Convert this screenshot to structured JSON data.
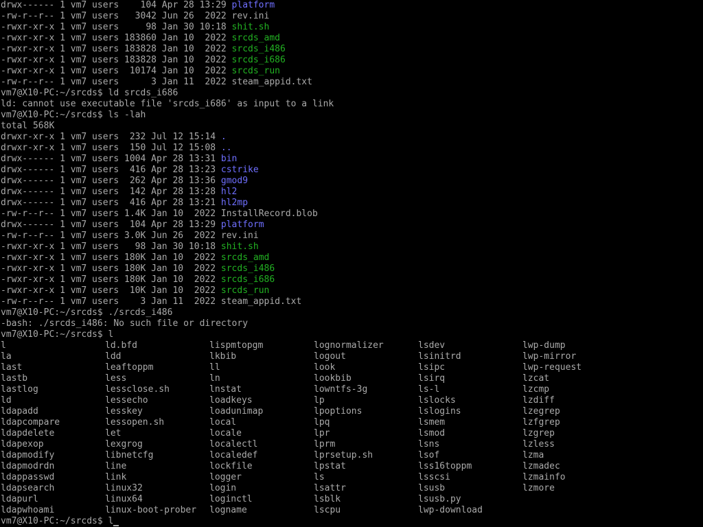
{
  "colors": {
    "background": "#000000",
    "text": "#aaaaaa",
    "directory": "#6f6fff",
    "executable": "#22b222"
  },
  "lines": [
    {
      "prefix": "drwx------ 1 vm7 users    104 Apr 28 13:29 ",
      "name": "platform",
      "kind": "dir"
    },
    {
      "prefix": "-rw-r--r-- 1 vm7 users   3042 Jun 26  2022 ",
      "name": "rev.ini",
      "kind": "plain"
    },
    {
      "prefix": "-rwxr-xr-x 1 vm7 users     98 Jan 30 10:18 ",
      "name": "shit.sh",
      "kind": "exec"
    },
    {
      "prefix": "-rwxr-xr-x 1 vm7 users 183860 Jan 10  2022 ",
      "name": "srcds_amd",
      "kind": "exec"
    },
    {
      "prefix": "-rwxr-xr-x 1 vm7 users 183828 Jan 10  2022 ",
      "name": "srcds_i486",
      "kind": "exec"
    },
    {
      "prefix": "-rwxr-xr-x 1 vm7 users 183828 Jan 10  2022 ",
      "name": "srcds_i686",
      "kind": "exec"
    },
    {
      "prefix": "-rwxr-xr-x 1 vm7 users  10174 Jan 10  2022 ",
      "name": "srcds_run",
      "kind": "exec"
    },
    {
      "prefix": "-rw-r--r-- 1 vm7 users      3 Jan 11  2022 ",
      "name": "steam_appid.txt",
      "kind": "plain"
    },
    {
      "prefix": "vm7@X10-PC:~/srcds$ ld srcds_i686",
      "name": "",
      "kind": "plain"
    },
    {
      "prefix": "ld: cannot use executable file 'srcds_i686' as input to a link",
      "name": "",
      "kind": "plain"
    },
    {
      "prefix": "vm7@X10-PC:~/srcds$ ls -lah",
      "name": "",
      "kind": "plain"
    },
    {
      "prefix": "total 568K",
      "name": "",
      "kind": "plain"
    },
    {
      "prefix": "drwxr-xr-x 1 vm7 users  232 Jul 12 15:14 ",
      "name": ".",
      "kind": "dir"
    },
    {
      "prefix": "drwxr-xr-x 1 vm7 users  150 Jul 12 15:08 ",
      "name": "..",
      "kind": "dir"
    },
    {
      "prefix": "drwx------ 1 vm7 users 1004 Apr 28 13:31 ",
      "name": "bin",
      "kind": "dir"
    },
    {
      "prefix": "drwx------ 1 vm7 users  416 Apr 28 13:23 ",
      "name": "cstrike",
      "kind": "dir"
    },
    {
      "prefix": "drwx------ 1 vm7 users  262 Apr 28 13:36 ",
      "name": "gmod9",
      "kind": "dir"
    },
    {
      "prefix": "drwx------ 1 vm7 users  142 Apr 28 13:28 ",
      "name": "hl2",
      "kind": "dir"
    },
    {
      "prefix": "drwx------ 1 vm7 users  416 Apr 28 13:21 ",
      "name": "hl2mp",
      "kind": "dir"
    },
    {
      "prefix": "-rw-r--r-- 1 vm7 users 1.4K Jan 10  2022 ",
      "name": "InstallRecord.blob",
      "kind": "plain"
    },
    {
      "prefix": "drwx------ 1 vm7 users  104 Apr 28 13:29 ",
      "name": "platform",
      "kind": "dir"
    },
    {
      "prefix": "-rw-r--r-- 1 vm7 users 3.0K Jun 26  2022 ",
      "name": "rev.ini",
      "kind": "plain"
    },
    {
      "prefix": "-rwxr-xr-x 1 vm7 users   98 Jan 30 10:18 ",
      "name": "shit.sh",
      "kind": "exec"
    },
    {
      "prefix": "-rwxr-xr-x 1 vm7 users 180K Jan 10  2022 ",
      "name": "srcds_amd",
      "kind": "exec"
    },
    {
      "prefix": "-rwxr-xr-x 1 vm7 users 180K Jan 10  2022 ",
      "name": "srcds_i486",
      "kind": "exec"
    },
    {
      "prefix": "-rwxr-xr-x 1 vm7 users 180K Jan 10  2022 ",
      "name": "srcds_i686",
      "kind": "exec"
    },
    {
      "prefix": "-rwxr-xr-x 1 vm7 users  10K Jan 10  2022 ",
      "name": "srcds_run",
      "kind": "exec"
    },
    {
      "prefix": "-rw-r--r-- 1 vm7 users    3 Jan 11  2022 ",
      "name": "steam_appid.txt",
      "kind": "plain"
    },
    {
      "prefix": "vm7@X10-PC:~/srcds$ ./srcds_i486",
      "name": "",
      "kind": "plain"
    },
    {
      "prefix": "-bash: ./srcds_i486: No such file or directory",
      "name": "",
      "kind": "plain"
    },
    {
      "prefix": "vm7@X10-PC:~/srcds$ l",
      "name": "",
      "kind": "plain"
    }
  ],
  "completions": [
    [
      "l",
      "ld.bfd",
      "lispmtopgm",
      "lognormalizer",
      "lsdev",
      "lwp-dump"
    ],
    [
      "la",
      "ldd",
      "lkbib",
      "logout",
      "lsinitrd",
      "lwp-mirror"
    ],
    [
      "last",
      "leaftoppm",
      "ll",
      "look",
      "lsipc",
      "lwp-request"
    ],
    [
      "lastb",
      "less",
      "ln",
      "lookbib",
      "lsirq",
      "lzcat"
    ],
    [
      "lastlog",
      "lessclose.sh",
      "lnstat",
      "lowntfs-3g",
      "ls-l",
      "lzcmp"
    ],
    [
      "ld",
      "lessecho",
      "loadkeys",
      "lp",
      "lslocks",
      "lzdiff"
    ],
    [
      "ldapadd",
      "lesskey",
      "loadunimap",
      "lpoptions",
      "lslogins",
      "lzegrep"
    ],
    [
      "ldapcompare",
      "lessopen.sh",
      "local",
      "lpq",
      "lsmem",
      "lzfgrep"
    ],
    [
      "ldapdelete",
      "let",
      "locale",
      "lpr",
      "lsmod",
      "lzgrep"
    ],
    [
      "ldapexop",
      "lexgrog",
      "localectl",
      "lprm",
      "lsns",
      "lzless"
    ],
    [
      "ldapmodify",
      "libnetcfg",
      "localedef",
      "lprsetup.sh",
      "lsof",
      "lzma"
    ],
    [
      "ldapmodrdn",
      "line",
      "lockfile",
      "lpstat",
      "lss16toppm",
      "lzmadec"
    ],
    [
      "ldappasswd",
      "link",
      "logger",
      "ls",
      "lsscsi",
      "lzmainfo"
    ],
    [
      "ldapsearch",
      "linux32",
      "login",
      "lsattr",
      "lsusb",
      "lzmore"
    ],
    [
      "ldapurl",
      "linux64",
      "loginctl",
      "lsblk",
      "lsusb.py",
      ""
    ],
    [
      "ldapwhoami",
      "linux-boot-prober",
      "logname",
      "lscpu",
      "lwp-download",
      ""
    ]
  ],
  "prompt": {
    "text": "vm7@X10-PC:~/srcds$ l"
  }
}
